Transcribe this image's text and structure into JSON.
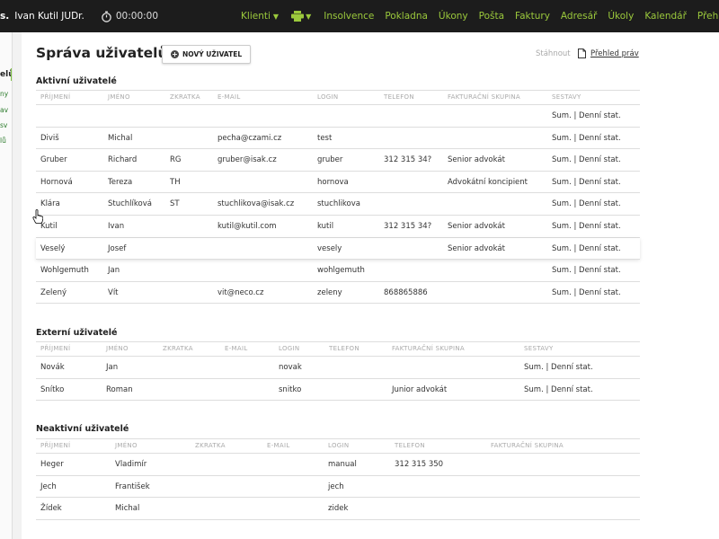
{
  "topbar": {
    "brand": "s.",
    "user": "Ivan Kutil JUDr.",
    "timer": "00:00:00",
    "menu": [
      "Klienti",
      "Insolvence",
      "Pokladna",
      "Úkony",
      "Pošta",
      "Faktury",
      "Adresář",
      "Úkoly",
      "Kalendář",
      "Přehledy"
    ]
  },
  "sidebar": {
    "items": [
      "elů",
      "ny",
      "av",
      "sv",
      "lů"
    ]
  },
  "page": {
    "title": "Správa uživatelů",
    "new_user_button": "NOVÝ UŽIVATEL",
    "download_label": "Stáhnout",
    "download_link": "Přehled práv"
  },
  "active": {
    "title": "Aktivní uživatelé",
    "columns": [
      "PŘÍJMENÍ",
      "JMÉNO",
      "ZKRATKA",
      "E-MAIL",
      "LOGIN",
      "TELEFON",
      "FAKTURAČNÍ SKUPINA",
      "SESTAVY"
    ],
    "rows": [
      [
        "",
        "",
        "",
        "",
        "",
        "",
        "",
        "Sum. | Denní stat."
      ],
      [
        "Diviš",
        "Michal",
        "",
        "pecha@czami.cz",
        "test",
        "",
        "",
        "Sum. | Denní stat."
      ],
      [
        "Gruber",
        "Richard",
        "RG",
        "gruber@isak.cz",
        "gruber",
        "312 315 34?",
        "Senior advokát",
        "Sum. | Denní stat."
      ],
      [
        "Hornová",
        "Tereza",
        "TH",
        "",
        "hornova",
        "",
        "Advokátní koncipient",
        "Sum. | Denní stat."
      ],
      [
        "Klára",
        "Stuchlíková",
        "ST",
        "stuchlikova@isak.cz",
        "stuchlikova",
        "",
        "",
        "Sum. | Denní stat."
      ],
      [
        "Kutil",
        "Ivan",
        "",
        "kutil@kutil.com",
        "kutil",
        "312 315 34?",
        "Senior advokát",
        "Sum. | Denní stat."
      ],
      [
        "Veselý",
        "Josef",
        "",
        "",
        "vesely",
        "",
        "Senior advokát",
        "Sum. | Denní stat."
      ],
      [
        "Wohlgemuth",
        "Jan",
        "",
        "",
        "wohlgemuth",
        "",
        "",
        "Sum. | Denní stat."
      ],
      [
        "Zelený",
        "Vít",
        "",
        "vit@neco.cz",
        "zeleny",
        "868865886",
        "",
        "Sum. | Denní stat."
      ]
    ]
  },
  "external": {
    "title": "Externí uživatelé",
    "columns": [
      "PŘÍJMENÍ",
      "JMÉNO",
      "ZKRATKA",
      "E-MAIL",
      "LOGIN",
      "TELEFON",
      "FAKTURAČNÍ SKUPINA",
      "SESTAVY"
    ],
    "rows": [
      [
        "Novák",
        "Jan",
        "",
        "",
        "novak",
        "",
        "",
        "Sum. | Denní stat."
      ],
      [
        "Snítko",
        "Roman",
        "",
        "",
        "snitko",
        "",
        "Junior advokát",
        "Sum. | Denní stat."
      ]
    ]
  },
  "inactive": {
    "title": "Neaktivní uživatelé",
    "columns": [
      "PŘÍJMENÍ",
      "JMÉNO",
      "ZKRATKA",
      "E-MAIL",
      "LOGIN",
      "TELEFON",
      "FAKTURAČNÍ SKUPINA"
    ],
    "rows": [
      [
        "Heger",
        "Vladimír",
        "",
        "",
        "manual",
        "312 315 350",
        ""
      ],
      [
        "Jech",
        "František",
        "",
        "",
        "jech",
        "",
        ""
      ],
      [
        "Žídek",
        "Michal",
        "",
        "",
        "zidek",
        "",
        ""
      ]
    ]
  },
  "colors": {
    "topbar_bg": "#1c1c1c",
    "menu_text": "#9bc93c",
    "accent": "#7cc242"
  }
}
